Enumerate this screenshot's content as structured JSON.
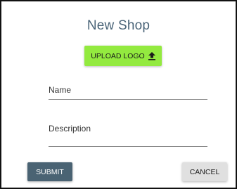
{
  "dialog": {
    "title": "New Shop"
  },
  "upload": {
    "label": "UPLOAD LOGO",
    "icon": "upload-icon",
    "color": "#93ea3f"
  },
  "form": {
    "name_label": "Name",
    "description_label": "Description"
  },
  "actions": {
    "submit_label": "SUBMIT",
    "cancel_label": "CANCEL",
    "submit_color": "#4a6373",
    "cancel_color": "#e0e0e0"
  }
}
